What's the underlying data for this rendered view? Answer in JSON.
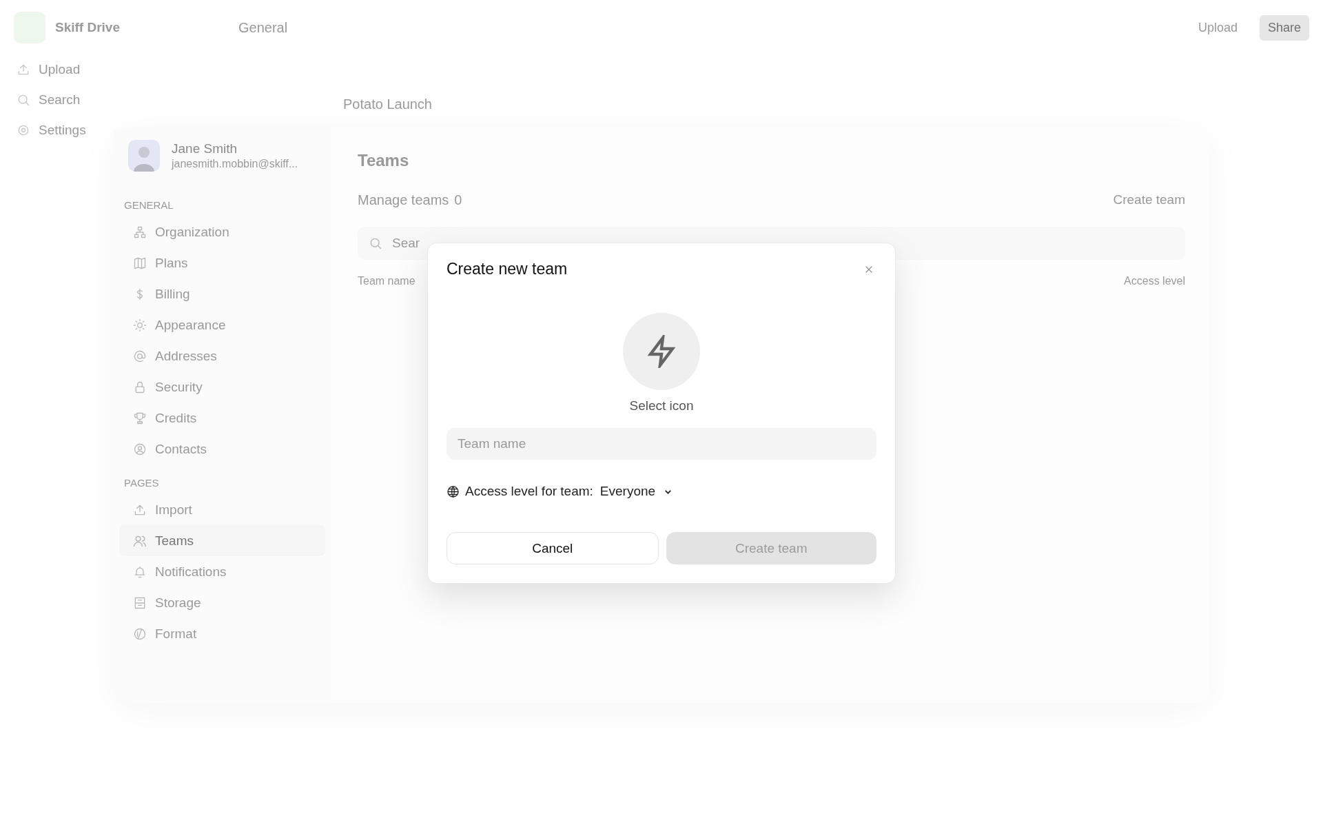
{
  "app": {
    "title": "Skiff Drive",
    "header": "General",
    "actions": [
      {
        "label": "Upload",
        "kind": "text"
      },
      {
        "label": "Share",
        "kind": "filled"
      }
    ],
    "sidebar": [
      {
        "label": "Upload"
      },
      {
        "label": "Search"
      },
      {
        "label": "Settings"
      }
    ],
    "folder": "Potato Launch"
  },
  "settings": {
    "user": {
      "name": "Jane Smith",
      "email": "janesmith.mobbin@skiff..."
    },
    "sections": [
      {
        "title": "GENERAL",
        "items": [
          {
            "label": "Organization",
            "selected": false
          },
          {
            "label": "Plans",
            "selected": false
          },
          {
            "label": "Billing",
            "selected": false
          },
          {
            "label": "Appearance",
            "selected": false
          },
          {
            "label": "Addresses",
            "selected": false
          },
          {
            "label": "Security",
            "selected": false
          },
          {
            "label": "Credits",
            "selected": false
          },
          {
            "label": "Contacts",
            "selected": false
          }
        ]
      },
      {
        "title": "PAGES",
        "items": [
          {
            "label": "Import",
            "selected": false
          },
          {
            "label": "Teams",
            "selected": true
          },
          {
            "label": "Notifications",
            "selected": false
          },
          {
            "label": "Storage",
            "selected": false
          },
          {
            "label": "Format",
            "selected": false
          }
        ]
      }
    ],
    "page": {
      "title": "Teams",
      "subtitle": "Manage teams",
      "count": "0",
      "action": "Create team",
      "search": {
        "placeholder": "Sear"
      },
      "columns": [
        "Team name",
        "Access level"
      ]
    }
  },
  "dialog": {
    "title": "Create new team",
    "icon_label": "Select icon",
    "name_field": {
      "placeholder": "Team name"
    },
    "access": {
      "label": "Access level for team:",
      "value": "Everyone"
    },
    "buttons": [
      {
        "label": "Cancel",
        "kind": "secondary",
        "disabled": false
      },
      {
        "label": "Create team",
        "kind": "primary",
        "disabled": true
      }
    ]
  }
}
